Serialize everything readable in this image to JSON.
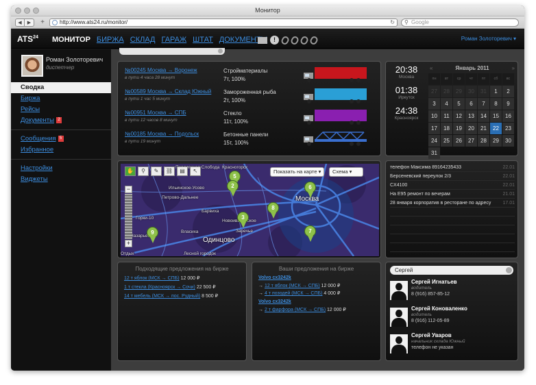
{
  "browser": {
    "window_title": "Монитор",
    "url": "http://www.ats24.ru/monitor/",
    "search_placeholder": "Google"
  },
  "app": {
    "logo": "ATS",
    "logo_sup": "24",
    "nav": {
      "active": "МОНИТОР",
      "links": [
        "БИРЖА",
        "СКЛАД",
        "ГАРАЖ",
        "ШТАТ",
        "ДОКУМЕНТЫ"
      ]
    },
    "notification_badge": "!",
    "user_menu": "Роман Золоторевич ▾"
  },
  "profile": {
    "name": "Роман Золоторевич",
    "role": "диспетчер"
  },
  "sidebar": {
    "items": [
      {
        "label": "Сводка",
        "active": true
      },
      {
        "label": "Биржа"
      },
      {
        "label": "Рейсы"
      },
      {
        "label": "Документы",
        "badge": "2"
      },
      {
        "label": "Сообщения",
        "badge": "5"
      },
      {
        "label": "Избранное"
      },
      {
        "label": "Настройки"
      },
      {
        "label": "Виджеты"
      }
    ]
  },
  "orders": [
    {
      "link": "№00245 Москва → Воронеж",
      "time": "в пути 4 часа 28 минут",
      "cargo": "Стройматериалы",
      "load": "7т, 100%",
      "truck_color": "#c8161d"
    },
    {
      "link": "№00589 Москва → Склад Южный",
      "time": "в пути 1 час 5 минут",
      "cargo": "Замороженная рыба",
      "load": "2т, 100%",
      "truck_color": "#2a9fd6"
    },
    {
      "link": "№00951 Москва → СПБ",
      "time": "в пути 12 часов 8 минут",
      "cargo": "Стекло",
      "load": "11т, 100%",
      "truck_color": "#8a1fb0"
    },
    {
      "link": "№00185 Москва → Подольск",
      "time": "в пути 19 минут",
      "cargo": "Бетонные панели",
      "load": "15т, 100%",
      "truck_color": "#3a6fcf"
    }
  ],
  "clocks": [
    {
      "time": "20:38",
      "city": "Москва"
    },
    {
      "time": "01:38",
      "city": "Иркутск"
    },
    {
      "time": "24:38",
      "city": "Красноярск"
    }
  ],
  "calendar": {
    "month": "Январь 2011",
    "prev_arrow": "«",
    "next_arrow": "»",
    "weekdays": [
      "пн",
      "вт",
      "ср",
      "чт",
      "пт",
      "сб",
      "вс"
    ],
    "days": [
      {
        "d": "27",
        "prev": true
      },
      {
        "d": "28",
        "prev": true
      },
      {
        "d": "29",
        "prev": true
      },
      {
        "d": "30",
        "prev": true
      },
      {
        "d": "31",
        "prev": true
      },
      {
        "d": "1"
      },
      {
        "d": "2"
      },
      {
        "d": "3"
      },
      {
        "d": "4"
      },
      {
        "d": "5"
      },
      {
        "d": "6"
      },
      {
        "d": "7"
      },
      {
        "d": "8"
      },
      {
        "d": "9"
      },
      {
        "d": "10"
      },
      {
        "d": "11"
      },
      {
        "d": "12"
      },
      {
        "d": "13"
      },
      {
        "d": "14"
      },
      {
        "d": "15"
      },
      {
        "d": "16"
      },
      {
        "d": "17"
      },
      {
        "d": "18"
      },
      {
        "d": "19"
      },
      {
        "d": "20"
      },
      {
        "d": "21"
      },
      {
        "d": "22",
        "today": true
      },
      {
        "d": "23"
      },
      {
        "d": "24"
      },
      {
        "d": "25"
      },
      {
        "d": "26"
      },
      {
        "d": "27"
      },
      {
        "d": "28"
      },
      {
        "d": "29"
      },
      {
        "d": "30"
      },
      {
        "d": "31"
      }
    ]
  },
  "map": {
    "show_on_map": "Показать на карте ▾",
    "scheme": "Схема ▾",
    "zoom_in": "+",
    "zoom_out": "−",
    "labels": [
      "Красногорск",
      "Ильинское-Усово",
      "Петрово-Дальнее",
      "Горки-10",
      "Барвиха",
      "Москва",
      "Новоивановское",
      "Заречье",
      "Власиха",
      "Одинцово",
      "Назарьево",
      "Лесной городок",
      "Отдых",
      "Павловская Слобода"
    ],
    "pins": [
      "5",
      "2",
      "6",
      "8",
      "3",
      "7",
      "9"
    ]
  },
  "messages": [
    {
      "text": "телефон Максима 89164235433",
      "date": "22.01"
    },
    {
      "text": "Берсеневский переулок 2/3",
      "date": "22.01"
    },
    {
      "text": "CX4100",
      "date": "22.01"
    },
    {
      "text": "На Е95 ремонт по вечерам",
      "date": "21.01"
    },
    {
      "text": "28 января корпоратив в ресторане по адресу",
      "date": "17.01"
    }
  ],
  "bids_left": {
    "title": "Подходящие предложения на бирже",
    "items": [
      {
        "link": "12 т яблок (МСК → СПБ)",
        "price": "12 000 ₽"
      },
      {
        "link": "1 т стекла (Красноярск → Сочи)",
        "price": "22 500 ₽"
      },
      {
        "link": "14 т мебель (МСК → пос. Рудный)",
        "price": "8 500 ₽"
      }
    ]
  },
  "bids_right": {
    "title": "Ваши предложения на бирже",
    "groups": [
      {
        "vehicle": "Volvo cx3242k",
        "items": [
          {
            "link": "12 т яблок (МСК → СПБ)",
            "price": "12 000 ₽"
          },
          {
            "link": "4 т позодей (МСК → СПБ)",
            "price": "4 000 ₽"
          }
        ]
      },
      {
        "vehicle": "Volvo cx3242k",
        "items": [
          {
            "link": "2 т фарфора (МСК → СПБ)",
            "price": "12 000 ₽"
          }
        ]
      }
    ]
  },
  "contacts": {
    "search_value": "Сергей",
    "items": [
      {
        "name": "Сергей Игнатьев",
        "role": "водитель",
        "phone": "8 (916) 857-85-12"
      },
      {
        "name": "Сергей Коноваленко",
        "role": "водитель",
        "phone": "8 (916) 112-05-89"
      },
      {
        "name": "Сергей Уваров",
        "role": "начальник склада Южный",
        "phone": "телефон не указан"
      }
    ]
  }
}
